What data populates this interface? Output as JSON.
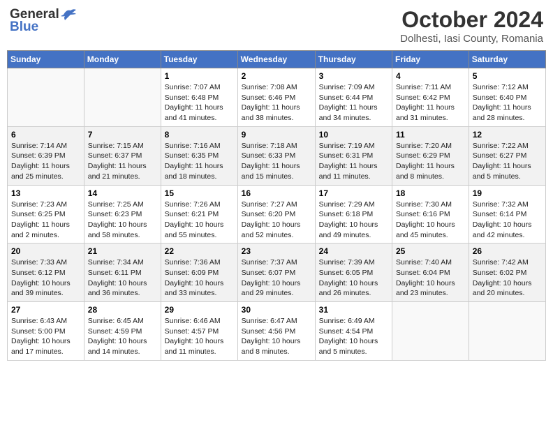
{
  "header": {
    "logo_line1": "General",
    "logo_line2": "Blue",
    "month": "October 2024",
    "location": "Dolhesti, Iasi County, Romania"
  },
  "weekdays": [
    "Sunday",
    "Monday",
    "Tuesday",
    "Wednesday",
    "Thursday",
    "Friday",
    "Saturday"
  ],
  "weeks": [
    [
      {
        "day": "",
        "info": ""
      },
      {
        "day": "",
        "info": ""
      },
      {
        "day": "1",
        "info": "Sunrise: 7:07 AM\nSunset: 6:48 PM\nDaylight: 11 hours and 41 minutes."
      },
      {
        "day": "2",
        "info": "Sunrise: 7:08 AM\nSunset: 6:46 PM\nDaylight: 11 hours and 38 minutes."
      },
      {
        "day": "3",
        "info": "Sunrise: 7:09 AM\nSunset: 6:44 PM\nDaylight: 11 hours and 34 minutes."
      },
      {
        "day": "4",
        "info": "Sunrise: 7:11 AM\nSunset: 6:42 PM\nDaylight: 11 hours and 31 minutes."
      },
      {
        "day": "5",
        "info": "Sunrise: 7:12 AM\nSunset: 6:40 PM\nDaylight: 11 hours and 28 minutes."
      }
    ],
    [
      {
        "day": "6",
        "info": "Sunrise: 7:14 AM\nSunset: 6:39 PM\nDaylight: 11 hours and 25 minutes."
      },
      {
        "day": "7",
        "info": "Sunrise: 7:15 AM\nSunset: 6:37 PM\nDaylight: 11 hours and 21 minutes."
      },
      {
        "day": "8",
        "info": "Sunrise: 7:16 AM\nSunset: 6:35 PM\nDaylight: 11 hours and 18 minutes."
      },
      {
        "day": "9",
        "info": "Sunrise: 7:18 AM\nSunset: 6:33 PM\nDaylight: 11 hours and 15 minutes."
      },
      {
        "day": "10",
        "info": "Sunrise: 7:19 AM\nSunset: 6:31 PM\nDaylight: 11 hours and 11 minutes."
      },
      {
        "day": "11",
        "info": "Sunrise: 7:20 AM\nSunset: 6:29 PM\nDaylight: 11 hours and 8 minutes."
      },
      {
        "day": "12",
        "info": "Sunrise: 7:22 AM\nSunset: 6:27 PM\nDaylight: 11 hours and 5 minutes."
      }
    ],
    [
      {
        "day": "13",
        "info": "Sunrise: 7:23 AM\nSunset: 6:25 PM\nDaylight: 11 hours and 2 minutes."
      },
      {
        "day": "14",
        "info": "Sunrise: 7:25 AM\nSunset: 6:23 PM\nDaylight: 10 hours and 58 minutes."
      },
      {
        "day": "15",
        "info": "Sunrise: 7:26 AM\nSunset: 6:21 PM\nDaylight: 10 hours and 55 minutes."
      },
      {
        "day": "16",
        "info": "Sunrise: 7:27 AM\nSunset: 6:20 PM\nDaylight: 10 hours and 52 minutes."
      },
      {
        "day": "17",
        "info": "Sunrise: 7:29 AM\nSunset: 6:18 PM\nDaylight: 10 hours and 49 minutes."
      },
      {
        "day": "18",
        "info": "Sunrise: 7:30 AM\nSunset: 6:16 PM\nDaylight: 10 hours and 45 minutes."
      },
      {
        "day": "19",
        "info": "Sunrise: 7:32 AM\nSunset: 6:14 PM\nDaylight: 10 hours and 42 minutes."
      }
    ],
    [
      {
        "day": "20",
        "info": "Sunrise: 7:33 AM\nSunset: 6:12 PM\nDaylight: 10 hours and 39 minutes."
      },
      {
        "day": "21",
        "info": "Sunrise: 7:34 AM\nSunset: 6:11 PM\nDaylight: 10 hours and 36 minutes."
      },
      {
        "day": "22",
        "info": "Sunrise: 7:36 AM\nSunset: 6:09 PM\nDaylight: 10 hours and 33 minutes."
      },
      {
        "day": "23",
        "info": "Sunrise: 7:37 AM\nSunset: 6:07 PM\nDaylight: 10 hours and 29 minutes."
      },
      {
        "day": "24",
        "info": "Sunrise: 7:39 AM\nSunset: 6:05 PM\nDaylight: 10 hours and 26 minutes."
      },
      {
        "day": "25",
        "info": "Sunrise: 7:40 AM\nSunset: 6:04 PM\nDaylight: 10 hours and 23 minutes."
      },
      {
        "day": "26",
        "info": "Sunrise: 7:42 AM\nSunset: 6:02 PM\nDaylight: 10 hours and 20 minutes."
      }
    ],
    [
      {
        "day": "27",
        "info": "Sunrise: 6:43 AM\nSunset: 5:00 PM\nDaylight: 10 hours and 17 minutes."
      },
      {
        "day": "28",
        "info": "Sunrise: 6:45 AM\nSunset: 4:59 PM\nDaylight: 10 hours and 14 minutes."
      },
      {
        "day": "29",
        "info": "Sunrise: 6:46 AM\nSunset: 4:57 PM\nDaylight: 10 hours and 11 minutes."
      },
      {
        "day": "30",
        "info": "Sunrise: 6:47 AM\nSunset: 4:56 PM\nDaylight: 10 hours and 8 minutes."
      },
      {
        "day": "31",
        "info": "Sunrise: 6:49 AM\nSunset: 4:54 PM\nDaylight: 10 hours and 5 minutes."
      },
      {
        "day": "",
        "info": ""
      },
      {
        "day": "",
        "info": ""
      }
    ]
  ]
}
